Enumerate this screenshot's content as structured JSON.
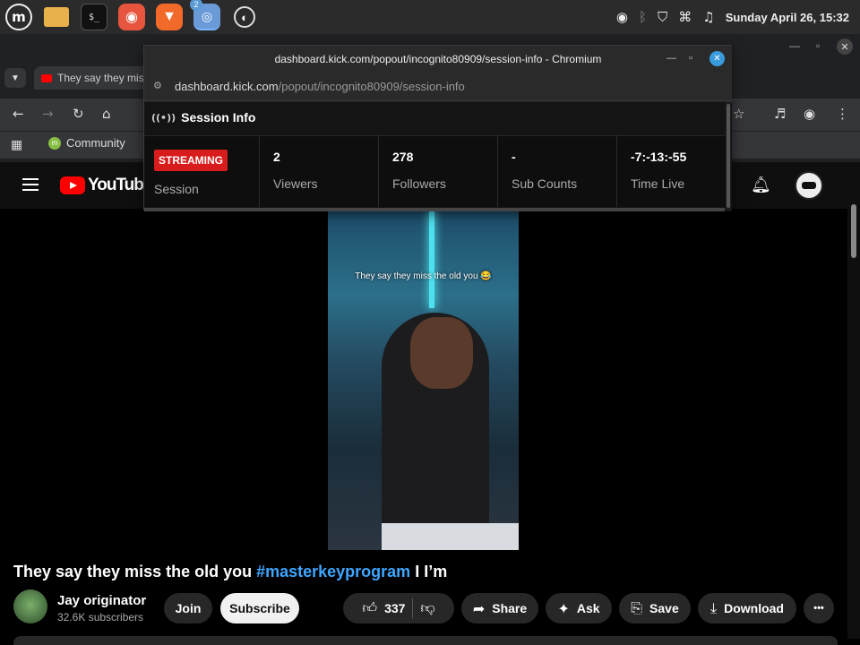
{
  "taskbar": {
    "clock": "Sunday April 26, 15:32",
    "chromium_badge": "2",
    "terminal_glyph": "$_"
  },
  "browser": {
    "tab_title": "They say they miss",
    "bookmark": "Community"
  },
  "popup": {
    "window_title": "dashboard.kick.com/popout/incognito80909/session-info - Chromium",
    "url_host": "dashboard.kick.com",
    "url_path": "/popout/incognito80909/session-info",
    "heading": "Session Info",
    "status_badge": "STREAMING",
    "stats": [
      {
        "value": "",
        "label": "Session"
      },
      {
        "value": "2",
        "label": "Viewers"
      },
      {
        "value": "278",
        "label": "Followers"
      },
      {
        "value": "-",
        "label": "Sub Counts"
      },
      {
        "value": "-7:-13:-55",
        "label": "Time Live"
      }
    ]
  },
  "youtube": {
    "logo_text": "YouTube",
    "video_caption": "They say they miss the old you 😂",
    "title_text": "They say they miss the old you ",
    "title_hashtag": "#masterkeyprogram",
    "title_tail": " I I’m",
    "channel_name": "Jay originator",
    "subscribers": "32.6K subscribers",
    "join_label": "Join",
    "subscribe_label": "Subscribe",
    "like_count": "337",
    "share_label": "Share",
    "ask_label": "Ask",
    "save_label": "Save",
    "download_label": "Download",
    "more_label": "•••"
  }
}
